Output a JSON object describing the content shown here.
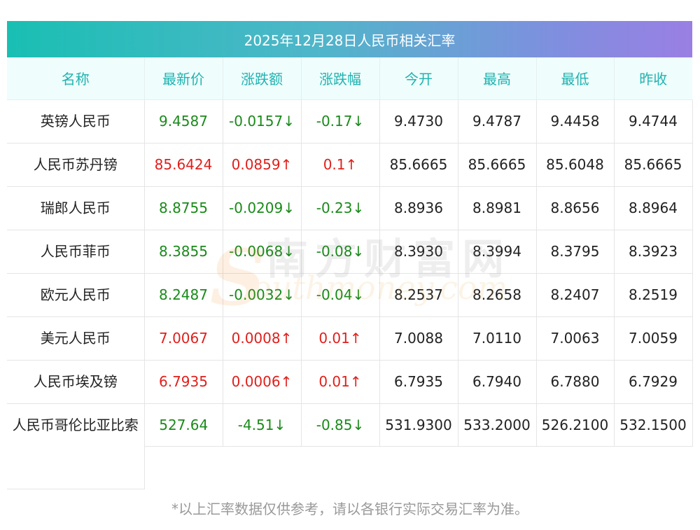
{
  "title": "2025年12月28日人民币相关汇率",
  "columns": [
    "名称",
    "最新价",
    "涨跌额",
    "涨跌幅",
    "今开",
    "最高",
    "最低",
    "昨收"
  ],
  "rows": [
    {
      "name": "英镑人民币",
      "latest": "9.4587",
      "change": "-0.0157↓",
      "pct": "-0.17↓",
      "open": "9.4730",
      "high": "9.4787",
      "low": "9.4458",
      "prev": "9.4744",
      "dir": "down"
    },
    {
      "name": "人民币苏丹镑",
      "latest": "85.6424",
      "change": "0.0859↑",
      "pct": "0.1↑",
      "open": "85.6665",
      "high": "85.6665",
      "low": "85.6048",
      "prev": "85.6665",
      "dir": "up"
    },
    {
      "name": "瑞郎人民币",
      "latest": "8.8755",
      "change": "-0.0209↓",
      "pct": "-0.23↓",
      "open": "8.8936",
      "high": "8.8981",
      "low": "8.8656",
      "prev": "8.8964",
      "dir": "down"
    },
    {
      "name": "人民币菲币",
      "latest": "8.3855",
      "change": "-0.0068↓",
      "pct": "-0.08↓",
      "open": "8.3930",
      "high": "8.3994",
      "low": "8.3795",
      "prev": "8.3923",
      "dir": "down"
    },
    {
      "name": "欧元人民币",
      "latest": "8.2487",
      "change": "-0.0032↓",
      "pct": "-0.04↓",
      "open": "8.2537",
      "high": "8.2658",
      "low": "8.2407",
      "prev": "8.2519",
      "dir": "down"
    },
    {
      "name": "美元人民币",
      "latest": "7.0067",
      "change": "0.0008↑",
      "pct": "0.01↑",
      "open": "7.0088",
      "high": "7.0110",
      "low": "7.0063",
      "prev": "7.0059",
      "dir": "up"
    },
    {
      "name": "人民币埃及镑",
      "latest": "6.7935",
      "change": "0.0006↑",
      "pct": "0.01↑",
      "open": "6.7935",
      "high": "6.7940",
      "low": "6.7880",
      "prev": "6.7929",
      "dir": "up"
    },
    {
      "name": "人民币哥伦比亚比索",
      "latest": "527.64",
      "change": "-4.51↓",
      "pct": "-0.85↓",
      "open": "531.9300",
      "high": "533.2000",
      "low": "526.2100",
      "prev": "532.1500",
      "dir": "down"
    }
  ],
  "watermark": {
    "cn": "南方财富网",
    "en": "outhmoney.com",
    "s": "S"
  },
  "footnote": "*以上汇率数据仅供参考，请以各银行实际交易汇率为准。",
  "colors": {
    "up": "#e0201c",
    "down": "#1a8a1a",
    "header_text": "#20b3b0"
  }
}
